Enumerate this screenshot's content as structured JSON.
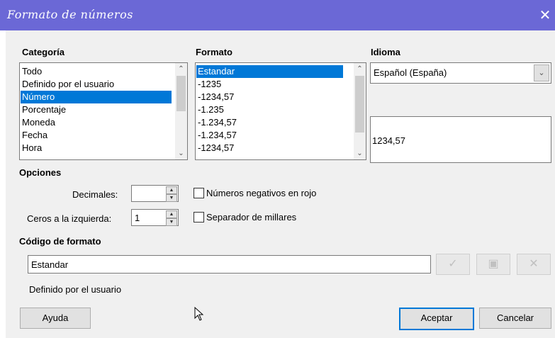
{
  "dialog": {
    "title": "Formato de números",
    "close_glyph": "✕"
  },
  "categoria": {
    "label": "Categoría",
    "items": [
      "Todo",
      "Definido por el usuario",
      "Número",
      "Porcentaje",
      "Moneda",
      "Fecha",
      "Hora"
    ],
    "selected_index": 2
  },
  "formato": {
    "label": "Formato",
    "items": [
      "Estandar",
      "-1235",
      "-1234,57",
      "-1.235",
      "-1.234,57",
      "-1.234,57",
      "-1234,57"
    ],
    "selected_index": 0
  },
  "idioma": {
    "label": "Idioma",
    "value": "Español (España)"
  },
  "preview": {
    "value": "1234,57"
  },
  "opciones": {
    "label": "Opciones",
    "decimales_label": "Decimales:",
    "decimales_value": "",
    "ceros_label": "Ceros a la izquierda:",
    "ceros_value": "1",
    "negativos_label": "Números negativos en rojo",
    "negativos_checked": false,
    "separador_label": "Separador de millares",
    "separador_checked": false
  },
  "codigo": {
    "label": "Código de formato",
    "value": "Estandar",
    "description": "Definido por el usuario"
  },
  "buttons": {
    "ayuda": "Ayuda",
    "aceptar": "Aceptar",
    "cancelar": "Cancelar"
  },
  "icons": {
    "accept": "check-icon",
    "comment": "comment-icon",
    "delete": "delete-icon"
  },
  "colors": {
    "titlebar": "#6b68d6",
    "selection": "#0078d7"
  }
}
